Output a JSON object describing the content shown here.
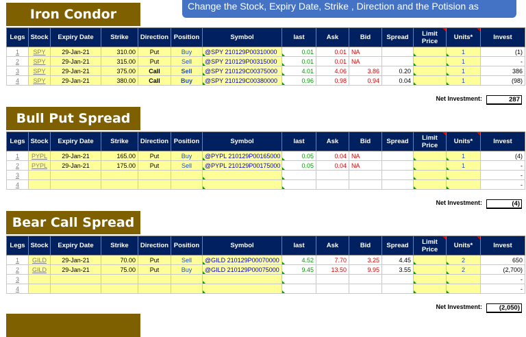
{
  "note": "Change the Stock, Expiry Date, Strike , Direction and the Potision as",
  "headers": [
    "Legs",
    "Stock",
    "Expiry Date",
    "Strike",
    "Direction",
    "Position",
    "Symbol",
    "last",
    "Ask",
    "Bid",
    "Spread",
    "Limit Price",
    "Units*",
    "Invest"
  ],
  "net_label": "Net Investment:",
  "strategies": [
    {
      "title": "Iron Condor",
      "net": "287",
      "rows": [
        {
          "leg": "1",
          "stock": "SPY",
          "expiry": "29-Jan-21",
          "strike": "310.00",
          "direction": "Put",
          "position": "Buy",
          "symbol": "@SPY  210129P00310000",
          "last": "0.01",
          "ask": "0.01",
          "bid": "NA",
          "spread": "",
          "limit": "",
          "units": "1",
          "invest": "(1)"
        },
        {
          "leg": "2",
          "stock": "SPY",
          "expiry": "29-Jan-21",
          "strike": "315.00",
          "direction": "Put",
          "position": "Sell",
          "symbol": "@SPY  210129P00315000",
          "last": "0.01",
          "ask": "0.01",
          "bid": "NA",
          "spread": "",
          "limit": "",
          "units": "1",
          "invest": "-"
        },
        {
          "leg": "3",
          "stock": "SPY",
          "expiry": "29-Jan-21",
          "strike": "375.00",
          "direction": "Call",
          "position": "Sell",
          "symbol": "@SPY  210129C00375000",
          "last": "4.01",
          "ask": "4.06",
          "bid": "3.86",
          "spread": "0.20",
          "limit": "",
          "units": "1",
          "invest": "386",
          "bold": true
        },
        {
          "leg": "4",
          "stock": "SPY",
          "expiry": "29-Jan-21",
          "strike": "380.00",
          "direction": "Call",
          "position": "Buy",
          "symbol": "@SPY  210129C00380000",
          "last": "0.96",
          "ask": "0.98",
          "bid": "0.94",
          "spread": "0.04",
          "limit": "",
          "units": "1",
          "invest": "(98)",
          "bold": true
        }
      ]
    },
    {
      "title": "Bull Put Spread",
      "net": "(4)",
      "rows": [
        {
          "leg": "1",
          "stock": "PYPL",
          "expiry": "29-Jan-21",
          "strike": "165.00",
          "direction": "Put",
          "position": "Buy",
          "symbol": "@PYPL  210129P00165000",
          "last": "0.05",
          "ask": "0.04",
          "bid": "NA",
          "spread": "",
          "limit": "",
          "units": "1",
          "invest": "(4)"
        },
        {
          "leg": "2",
          "stock": "PYPL",
          "expiry": "29-Jan-21",
          "strike": "175.00",
          "direction": "Put",
          "position": "Sell",
          "symbol": "@PYPL  210129P00175000",
          "last": "0.05",
          "ask": "0.04",
          "bid": "NA",
          "spread": "",
          "limit": "",
          "units": "1",
          "invest": "-"
        },
        {
          "leg": "3",
          "stock": "",
          "expiry": "",
          "strike": "",
          "direction": "",
          "position": "",
          "symbol": "",
          "last": "",
          "ask": "",
          "bid": "",
          "spread": "",
          "limit": "",
          "units": "",
          "invest": "-"
        },
        {
          "leg": "4",
          "stock": "",
          "expiry": "",
          "strike": "",
          "direction": "",
          "position": "",
          "symbol": "",
          "last": "",
          "ask": "",
          "bid": "",
          "spread": "",
          "limit": "",
          "units": "",
          "invest": "-"
        }
      ]
    },
    {
      "title": "Bear Call Spread",
      "net": "(2,050)",
      "rows": [
        {
          "leg": "1",
          "stock": "GILD",
          "expiry": "29-Jan-21",
          "strike": "70.00",
          "direction": "Put",
          "position": "Sell",
          "symbol": "@GILD  210129P00070000",
          "last": "4.52",
          "ask": "7.70",
          "bid": "3.25",
          "spread": "4.45",
          "limit": "",
          "units": "2",
          "invest": "650"
        },
        {
          "leg": "2",
          "stock": "GILD",
          "expiry": "29-Jan-21",
          "strike": "75.00",
          "direction": "Put",
          "position": "Buy",
          "symbol": "@GILD  210129P00075000",
          "last": "9.45",
          "ask": "13.50",
          "bid": "9.95",
          "spread": "3.55",
          "limit": "",
          "units": "2",
          "invest": "(2,700)"
        },
        {
          "leg": "3",
          "stock": "",
          "expiry": "",
          "strike": "",
          "direction": "",
          "position": "",
          "symbol": "",
          "last": "",
          "ask": "",
          "bid": "",
          "spread": "",
          "limit": "",
          "units": "",
          "invest": "-"
        },
        {
          "leg": "4",
          "stock": "",
          "expiry": "",
          "strike": "",
          "direction": "",
          "position": "",
          "symbol": "",
          "last": "",
          "ask": "",
          "bid": "",
          "spread": "",
          "limit": "",
          "units": "",
          "invest": "-"
        }
      ]
    }
  ],
  "colors": {
    "title_bg": "#7f6000",
    "header_bg": "#002060",
    "input_bg": "#ffff99",
    "note_bg": "#4472c4"
  }
}
